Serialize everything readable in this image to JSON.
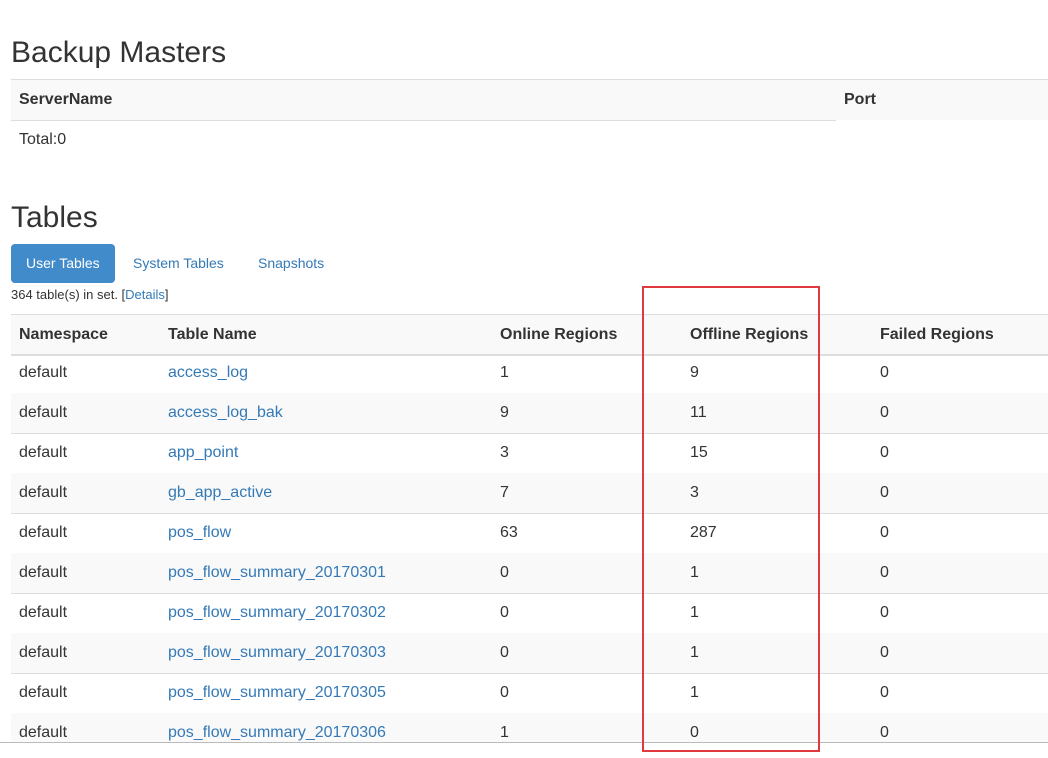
{
  "backup_masters": {
    "title": "Backup Masters",
    "columns": [
      "ServerName",
      "Port"
    ],
    "total": "Total:0"
  },
  "tables": {
    "title": "Tables",
    "tabs": [
      {
        "label": "User Tables",
        "active": true
      },
      {
        "label": "System Tables",
        "active": false
      },
      {
        "label": "Snapshots",
        "active": false
      }
    ],
    "info": {
      "prefix": "364 table(s) in set. [",
      "details_link": "Details",
      "suffix": "]"
    },
    "columns": [
      "Namespace",
      "Table Name",
      "Online Regions",
      "Offline Regions",
      "Failed Regions"
    ],
    "rows": [
      {
        "namespace": "default",
        "name": "access_log",
        "online": "1",
        "offline": "9",
        "failed": "0"
      },
      {
        "namespace": "default",
        "name": "access_log_bak",
        "online": "9",
        "offline": "11",
        "failed": "0"
      },
      {
        "namespace": "default",
        "name": "app_point",
        "online": "3",
        "offline": "15",
        "failed": "0"
      },
      {
        "namespace": "default",
        "name": "gb_app_active",
        "online": "7",
        "offline": "3",
        "failed": "0"
      },
      {
        "namespace": "default",
        "name": "pos_flow",
        "online": "63",
        "offline": "287",
        "failed": "0"
      },
      {
        "namespace": "default",
        "name": "pos_flow_summary_20170301",
        "online": "0",
        "offline": "1",
        "failed": "0"
      },
      {
        "namespace": "default",
        "name": "pos_flow_summary_20170302",
        "online": "0",
        "offline": "1",
        "failed": "0"
      },
      {
        "namespace": "default",
        "name": "pos_flow_summary_20170303",
        "online": "0",
        "offline": "1",
        "failed": "0"
      },
      {
        "namespace": "default",
        "name": "pos_flow_summary_20170305",
        "online": "0",
        "offline": "1",
        "failed": "0"
      },
      {
        "namespace": "default",
        "name": "pos_flow_summary_20170306",
        "online": "1",
        "offline": "0",
        "failed": "0"
      }
    ]
  },
  "colors": {
    "link": "#337ab7",
    "active_tab": "#428bca",
    "highlight": "#e0393e",
    "stripe": "#f9f9f9"
  }
}
